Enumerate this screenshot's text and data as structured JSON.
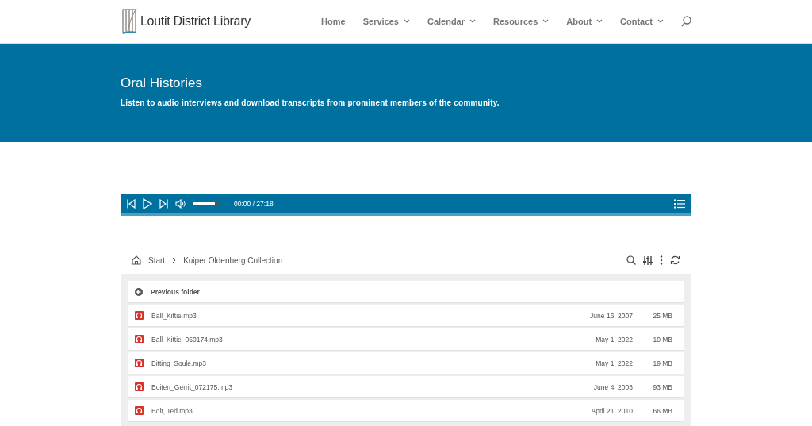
{
  "logo": {
    "text": "Loutit District Library"
  },
  "nav": [
    {
      "label": "Home",
      "has_menu": false
    },
    {
      "label": "Services",
      "has_menu": true
    },
    {
      "label": "Calendar",
      "has_menu": true
    },
    {
      "label": "Resources",
      "has_menu": true
    },
    {
      "label": "About",
      "has_menu": true
    },
    {
      "label": "Contact",
      "has_menu": true
    }
  ],
  "banner": {
    "title": "Oral Histories",
    "subtitle": "Listen to audio interviews and download transcripts from prominent members of the community."
  },
  "player": {
    "volume": {
      "level": 0.8
    },
    "time": "00:00 / 27:18"
  },
  "breadcrumb": [
    "Start",
    "Kuiper Oldenberg Collection"
  ],
  "files": [
    {
      "kind": "back",
      "name": "Previous folder"
    },
    {
      "kind": "audio",
      "name": "Ball_Kittie.mp3",
      "date": "June 16, 2007",
      "size": "25 MB"
    },
    {
      "kind": "audio",
      "name": "Ball_Kittie_050174.mp3",
      "date": "May 1, 2022",
      "size": "10 MB"
    },
    {
      "kind": "audio",
      "name": "Bitting_Soule.mp3",
      "date": "May 1, 2022",
      "size": "19 MB"
    },
    {
      "kind": "audio",
      "name": "Boiten_Gerrit_072175.mp3",
      "date": "June 4, 2008",
      "size": "93 MB"
    },
    {
      "kind": "audio",
      "name": "Bolt, Ted.mp3",
      "date": "April 21, 2010",
      "size": "66 MB"
    }
  ]
}
